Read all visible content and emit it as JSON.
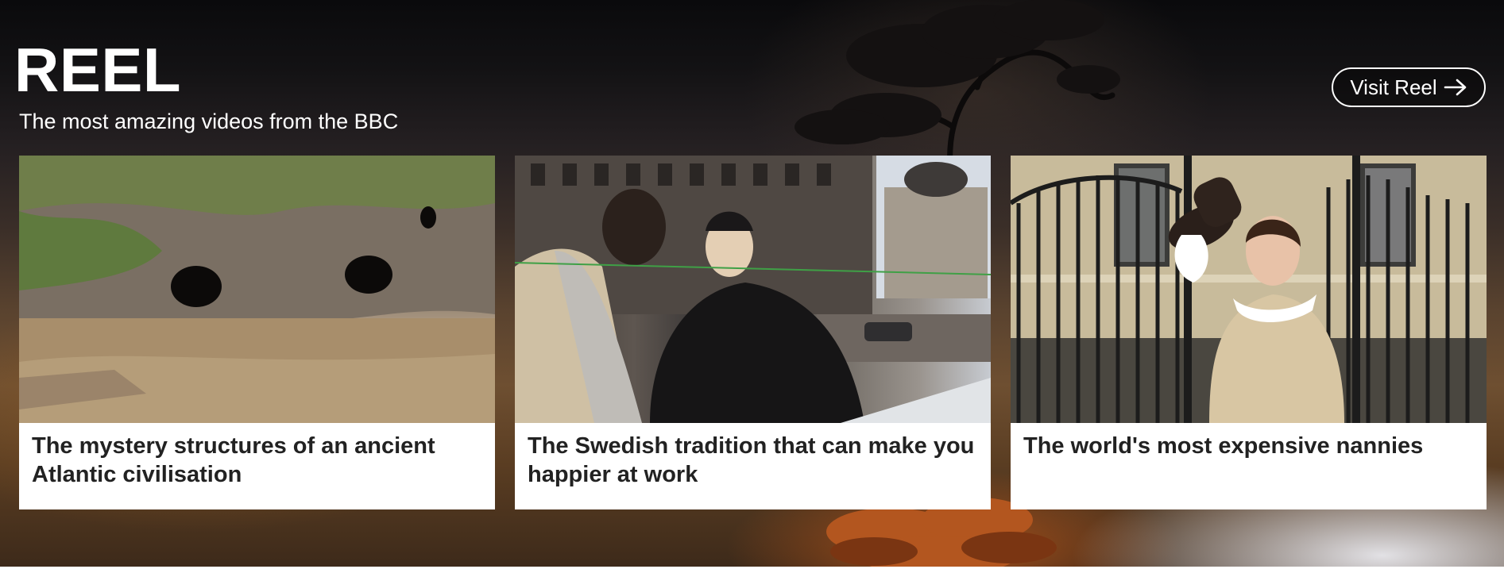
{
  "header": {
    "title": "REEL",
    "subtitle": "The most amazing videos from the BBC",
    "visit_button_label": "Visit Reel"
  },
  "cards": [
    {
      "title": "The mystery structures of an ancient Atlantic civilisation",
      "image": "cliff-caves-image"
    },
    {
      "title": "The Swedish tradition that can make you happier at work",
      "image": "cafe-window-image"
    },
    {
      "title": "The world's most expensive nannies",
      "image": "nanny-gate-image"
    }
  ],
  "colors": {
    "card_background": "#ffffff",
    "card_title": "#222222",
    "header_text": "#ffffff"
  },
  "icons": {
    "visit_arrow": "arrow-right-icon"
  }
}
